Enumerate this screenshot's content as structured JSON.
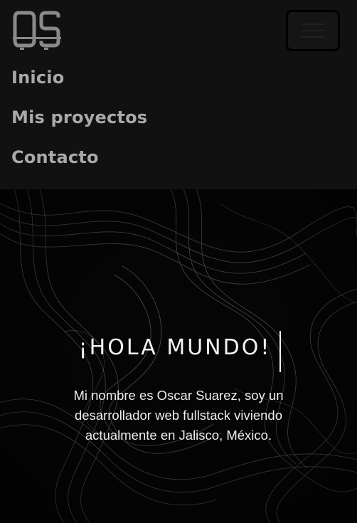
{
  "brand": {
    "logo_text": "OS"
  },
  "navbar": {
    "toggler_icon": "hamburger-icon",
    "links": [
      {
        "label": "Inicio"
      },
      {
        "label": "Mis proyectos"
      },
      {
        "label": "Contacto"
      }
    ]
  },
  "hero": {
    "title": "¡HOLA MUNDO!",
    "intro": "Mi nombre es Oscar Suarez, soy un desarrollador web fullstack viviendo actualmente en Jalisco, México."
  },
  "colors": {
    "navbar_bg": "#111111",
    "nav_link": "#a9a9a9",
    "hero_text": "#ededed"
  }
}
